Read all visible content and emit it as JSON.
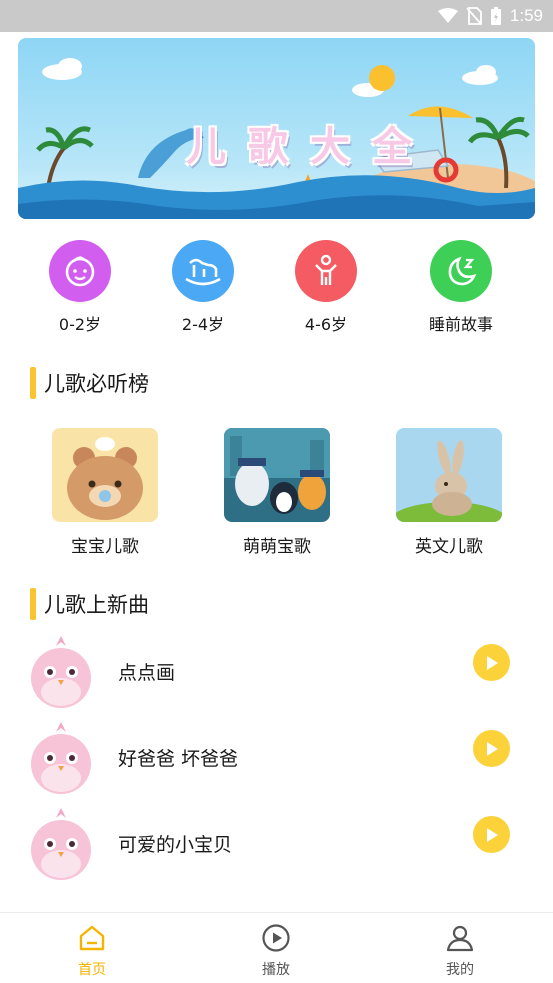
{
  "status_bar": {
    "time": "1:59"
  },
  "banner": {
    "title_chars": [
      "儿",
      "歌",
      "大",
      "全"
    ]
  },
  "categories": [
    {
      "label": "0-2岁",
      "icon": "baby-face-icon",
      "color": "#d25ef0"
    },
    {
      "label": "2-4岁",
      "icon": "rocking-horse-icon",
      "color": "#4aa8f5"
    },
    {
      "label": "4-6岁",
      "icon": "child-icon",
      "color": "#f45b62"
    },
    {
      "label": "睡前故事",
      "icon": "moon-icon",
      "color": "#3ecf57"
    }
  ],
  "hot_section": {
    "title": "儿歌必听榜",
    "items": [
      {
        "label": "宝宝儿歌"
      },
      {
        "label": "萌萌宝歌"
      },
      {
        "label": "英文儿歌"
      }
    ]
  },
  "new_section": {
    "title": "儿歌上新曲",
    "songs": [
      {
        "title": "点点画"
      },
      {
        "title": "好爸爸 坏爸爸"
      },
      {
        "title": "可爱的小宝贝"
      }
    ]
  },
  "tabbar": {
    "tabs": [
      {
        "label": "首页",
        "icon": "home-icon",
        "active": true
      },
      {
        "label": "播放",
        "icon": "play-circle-icon",
        "active": false
      },
      {
        "label": "我的",
        "icon": "profile-icon",
        "active": false
      }
    ]
  },
  "colors": {
    "accent": "#f8c531",
    "play_button": "#fbd23a",
    "status_bar": "#c9c9c9"
  }
}
